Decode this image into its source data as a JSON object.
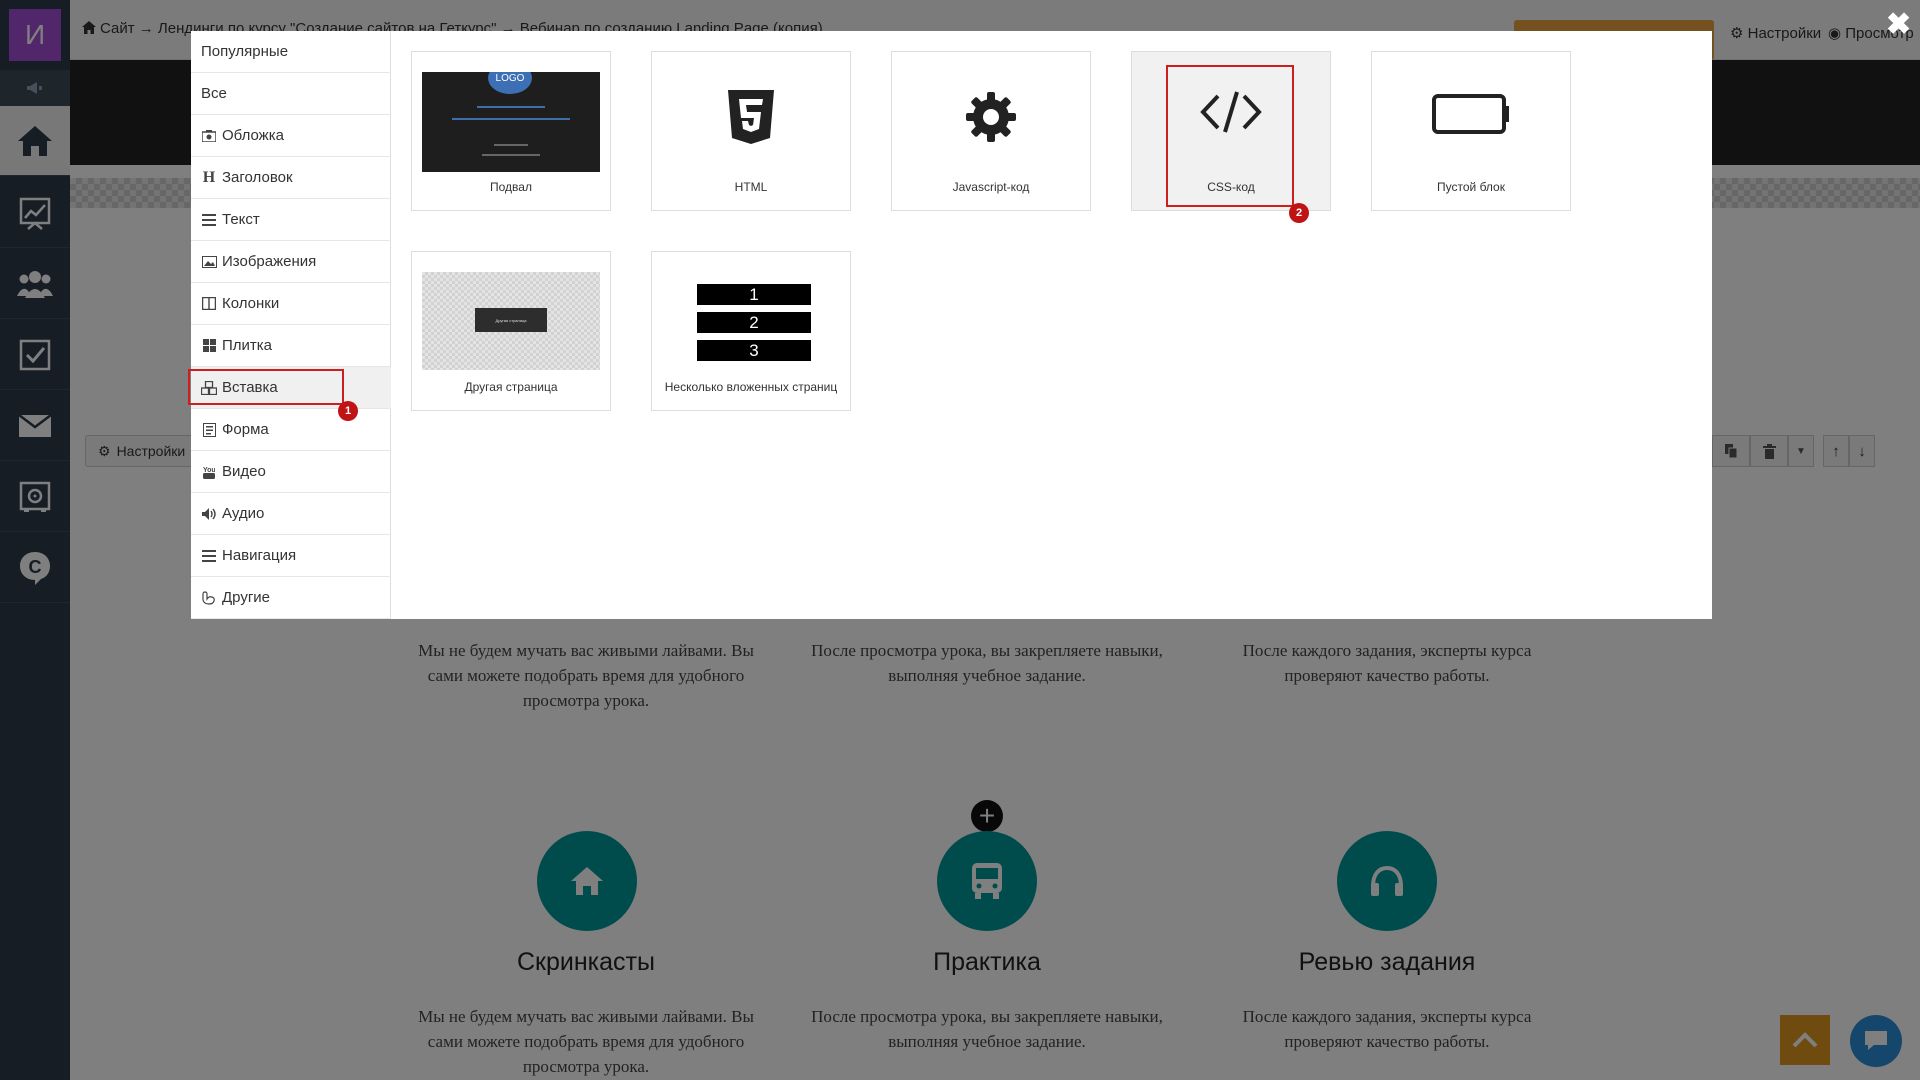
{
  "app": {
    "logo_letter": "И",
    "nav_icons": [
      "home-icon",
      "chart-icon",
      "users-icon",
      "tasks-icon",
      "mail-icon",
      "safe-icon",
      "chat-c-icon"
    ]
  },
  "topbar": {
    "breadcrumb": "Сайт → Лендинги по курсу \"Создание сайтов на Геткурс\" → Вебинар по созданию Landing Page (копия)",
    "settings_label": "Настройки",
    "preview_label": "Просмотр"
  },
  "modal": {
    "menu": [
      {
        "label": "Популярные",
        "icon": ""
      },
      {
        "label": "Все",
        "icon": ""
      },
      {
        "label": "Обложка",
        "icon": "camera-icon"
      },
      {
        "label": "Заголовок",
        "icon": "header-icon"
      },
      {
        "label": "Текст",
        "icon": "lines-icon"
      },
      {
        "label": "Изображения",
        "icon": "image-icon"
      },
      {
        "label": "Колонки",
        "icon": "columns-icon"
      },
      {
        "label": "Плитка",
        "icon": "tiles-icon"
      },
      {
        "label": "Вставка",
        "icon": "cubes-icon"
      },
      {
        "label": "Форма",
        "icon": "form-icon"
      },
      {
        "label": "Видео",
        "icon": "youtube-icon"
      },
      {
        "label": "Аудио",
        "icon": "volume-icon"
      },
      {
        "label": "Навигация",
        "icon": "bars-icon"
      },
      {
        "label": "Другие",
        "icon": "paw-icon"
      }
    ],
    "selected_menu": "Вставка",
    "tiles": [
      {
        "label": "Подвал",
        "icon": "footer-preview"
      },
      {
        "label": "HTML",
        "icon": "html5-icon"
      },
      {
        "label": "Javascript-код",
        "icon": "gear-icon"
      },
      {
        "label": "CSS-код",
        "icon": "code-icon"
      },
      {
        "label": "Пустой блок",
        "icon": "battery-empty-icon"
      },
      {
        "label": "Другая страница",
        "icon": "page-preview"
      },
      {
        "label": "Несколько вложенных страниц",
        "icon": "nested-pages-preview",
        "numbers": [
          "1",
          "2",
          "3"
        ]
      }
    ],
    "footer_preview_logo": "LOGO",
    "page_preview_button": "Другая страница",
    "markers": [
      "1",
      "2"
    ]
  },
  "background": {
    "block_settings_label": "Настройки",
    "features_top_text": [
      "Мы не будем мучать вас живыми лайвами. Вы сами можете подобрать время для удобного просмотра урока.",
      "После просмотра урока, вы закрепляете навыки, выполняя учебное задание.",
      "После каждого задания, эксперты курса проверяют качество работы."
    ],
    "features": [
      {
        "title": "Скринкасты",
        "text": "Мы не будем мучать вас живыми лайвами. Вы сами можете подобрать время для удобного просмотра урока.",
        "icon": "home-icon"
      },
      {
        "title": "Практика",
        "text": "После просмотра урока, вы закрепляете навыки, выполняя учебное задание.",
        "icon": "bus-icon"
      },
      {
        "title": "Ревью задания",
        "text": "После каждого задания, эксперты курса проверяют качество работы.",
        "icon": "headphones-icon"
      }
    ],
    "colors": {
      "accent": "#009999",
      "orange": "#e0961f",
      "sidebar": "#2e3b48",
      "highlight": "#cc1f1f"
    }
  }
}
